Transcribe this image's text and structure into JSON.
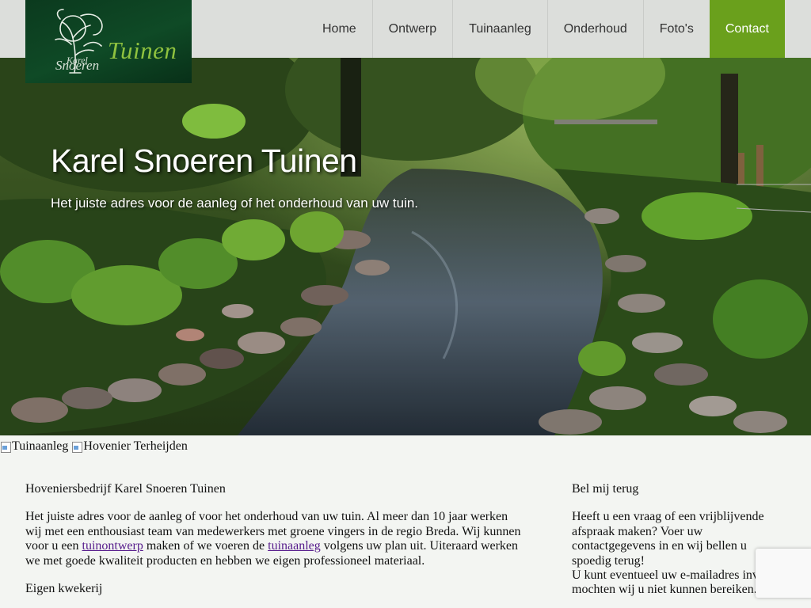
{
  "logo": {
    "word": "Tuinen",
    "karel": "Karel",
    "snoeren": "Snoeren"
  },
  "nav": {
    "items": [
      {
        "label": "Home"
      },
      {
        "label": "Ontwerp"
      },
      {
        "label": "Tuinaanleg"
      },
      {
        "label": "Onderhoud"
      },
      {
        "label": "Foto's"
      },
      {
        "label": "Contact"
      }
    ],
    "active_color": "#6aa01c"
  },
  "hero": {
    "title": "Karel Snoeren Tuinen",
    "subtitle": "Het juiste adres voor de aanleg of het onderhoud van uw tuin."
  },
  "images": [
    {
      "alt": "Tuinaanleg"
    },
    {
      "alt": "Hovenier Terheijden"
    }
  ],
  "main": {
    "heading": "Hoveniersbedrijf Karel Snoeren Tuinen",
    "para_before_link1": "Het juiste adres voor de aanleg of voor het onderhoud van uw tuin. Al meer dan 10 jaar werken wij met een enthousiast team van medewerkers met groene vingers in de regio Breda. Wij kunnen voor u een ",
    "link1": "tuinontwerp",
    "para_between": " maken of we voeren de ",
    "link2": "tuinaanleg",
    "para_after": " volgens uw plan uit. Uiteraard werken we met goede kwaliteit producten en hebben we eigen professioneel materiaal.",
    "subheading": "Eigen kwekerij"
  },
  "side": {
    "heading": "Bel mij terug",
    "text1": "Heeft u een vraag of een vrijblijvende afspraak maken? Voer uw contactgegevens in en wij bellen u spoedig terug!",
    "text2": "U kunt eventueel uw e-mailadres invullen mochten wij u niet kunnen bereiken."
  }
}
